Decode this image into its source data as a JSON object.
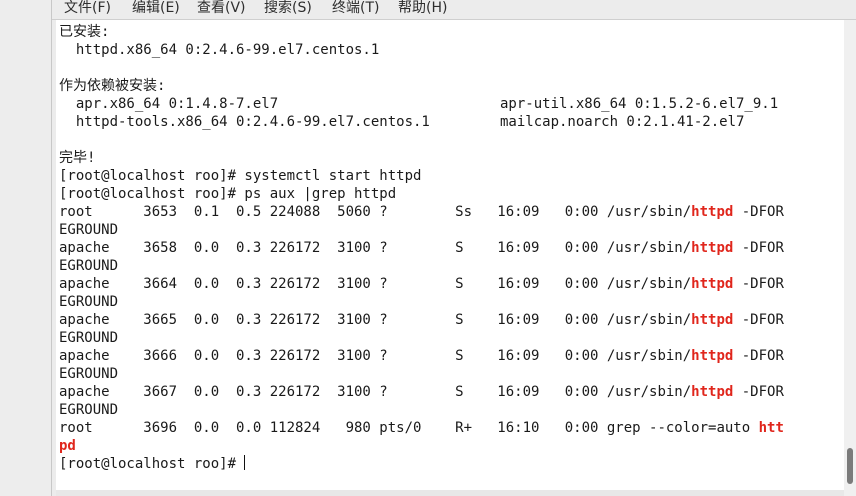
{
  "menubar": {
    "file": "文件(F)",
    "edit": "编辑(E)",
    "view": "查看(V)",
    "search": "搜索(S)",
    "terminal": "终端(T)",
    "help": "帮助(H)"
  },
  "terminal": {
    "installed_header": "已安装:",
    "installed_pkg": "  httpd.x86_64 0:2.4.6-99.el7.centos.1",
    "deps_header": "作为依赖被安装:",
    "dep_row1_left": "  apr.x86_64 0:1.4.8-7.el7",
    "dep_row1_right": "apr-util.x86_64 0:1.5.2-6.el7_9.1",
    "dep_row2_left": "  httpd-tools.x86_64 0:2.4.6-99.el7.centos.1",
    "dep_row2_right": "mailcap.noarch 0:2.1.41-2.el7",
    "done": "完毕!",
    "cmd1": "[root@localhost roo]# systemctl start httpd",
    "cmd2": "[root@localhost roo]# ps aux |grep httpd",
    "proc1": "root      3653  0.1  0.5 224088  5060 ?        Ss   16:09   0:00 /usr/sbin/",
    "proc2": "apache    3658  0.0  0.3 226172  3100 ?        S    16:09   0:00 /usr/sbin/",
    "proc3": "apache    3664  0.0  0.3 226172  3100 ?        S    16:09   0:00 /usr/sbin/",
    "proc4": "apache    3665  0.0  0.3 226172  3100 ?        S    16:09   0:00 /usr/sbin/",
    "proc5": "apache    3666  0.0  0.3 226172  3100 ?        S    16:09   0:00 /usr/sbin/",
    "proc6": "apache    3667  0.0  0.3 226172  3100 ?        S    16:09   0:00 /usr/sbin/",
    "match": "httpd",
    "dforeground_a": " -DFOR",
    "dforeground_b": "EGROUND",
    "grep_line": "root      3696  0.0  0.0 112824   980 pts/0    R+   16:10   0:00 grep --color=auto ",
    "grep_match_a": "htt",
    "grep_match_b": "pd",
    "prompt": "[root@localhost roo]# "
  },
  "colors": {
    "match_highlight": "#e0261c",
    "terminal_bg": "#ffffff",
    "terminal_fg": "#1a1a1a"
  }
}
